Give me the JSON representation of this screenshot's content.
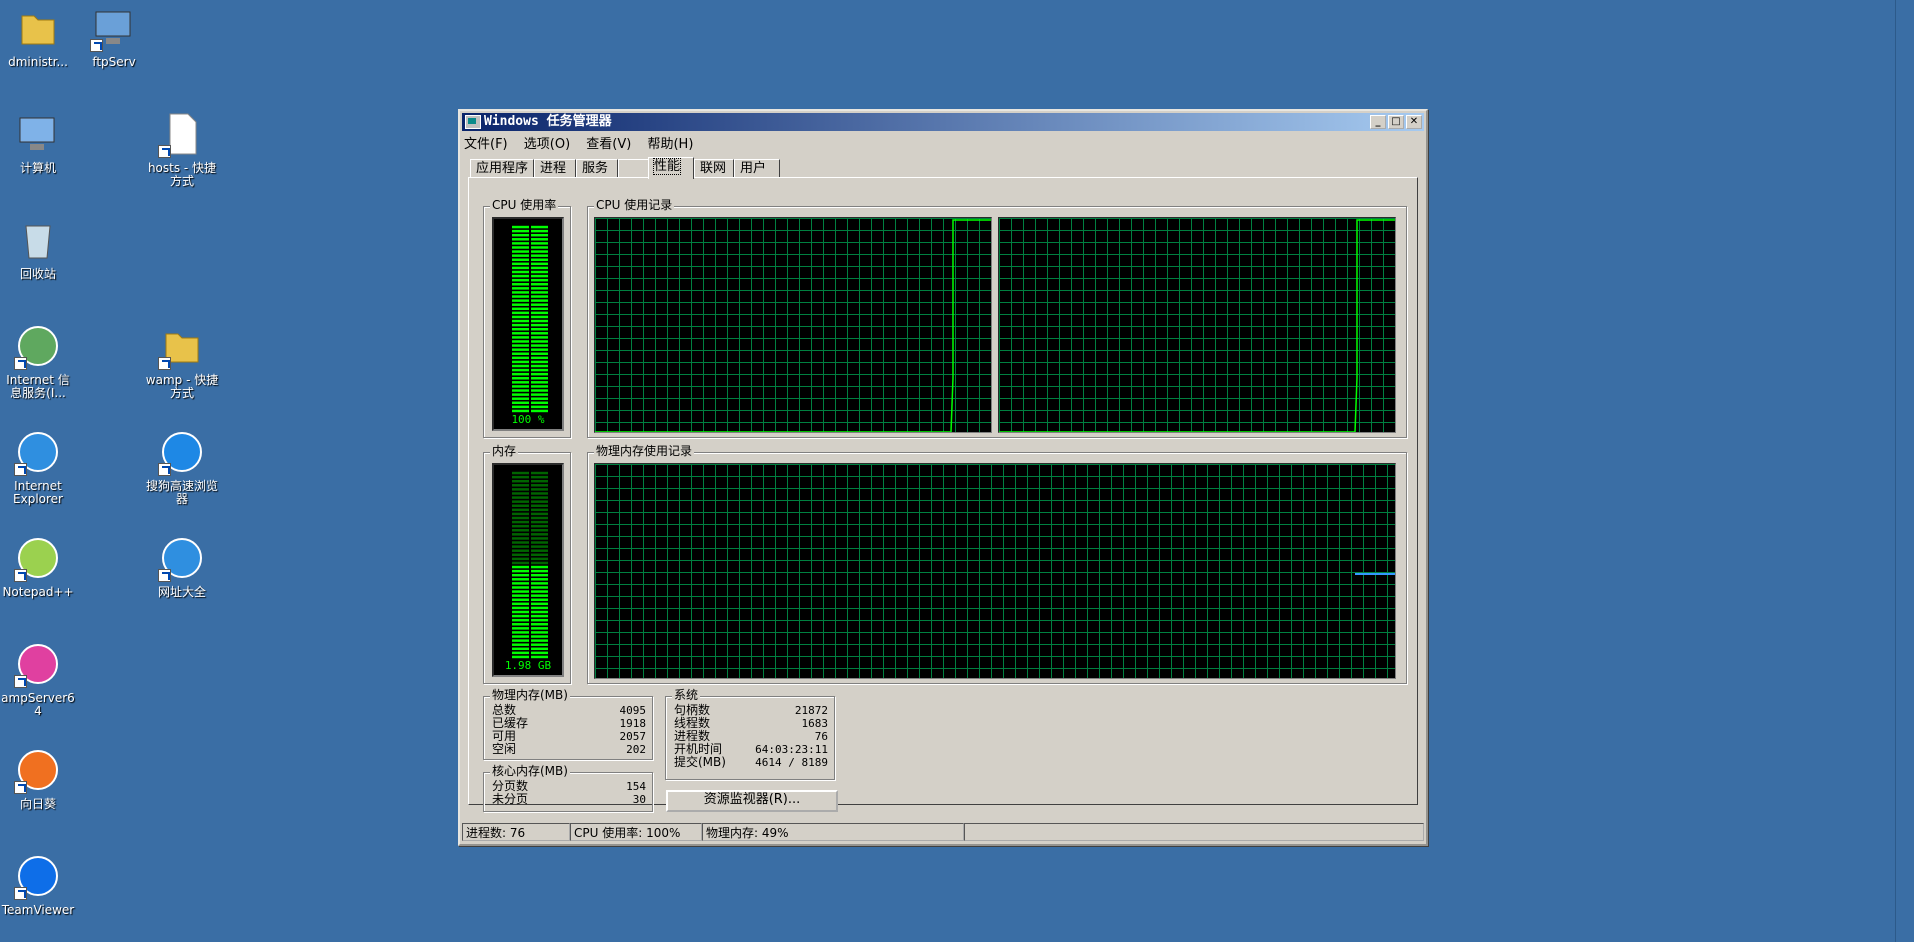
{
  "desktop": {
    "icons": [
      {
        "label": "dministr...",
        "icon": "folder-user-icon"
      },
      {
        "label": "ftpServ",
        "icon": "network-computers-icon"
      },
      {
        "label": "计算机",
        "icon": "computer-icon"
      },
      {
        "label": "hosts - 快捷\n方式",
        "icon": "file-shortcut-icon"
      },
      {
        "label": "回收站",
        "icon": "recycle-bin-icon"
      },
      {
        "label": "Internet 信\n息服务(I...",
        "icon": "iis-manager-icon"
      },
      {
        "label": "wamp - 快捷\n方式",
        "icon": "folder-shortcut-icon"
      },
      {
        "label": "Internet\nExplorer",
        "icon": "ie-icon"
      },
      {
        "label": "搜狗高速浏览\n器",
        "icon": "sogou-browser-icon"
      },
      {
        "label": "Notepad++",
        "icon": "notepadpp-icon"
      },
      {
        "label": "网址大全",
        "icon": "ie-icon"
      },
      {
        "label": "ampServer64",
        "icon": "wampserver-icon"
      },
      {
        "label": "向日葵",
        "icon": "sunflower-icon"
      },
      {
        "label": "TeamViewer",
        "icon": "teamviewer-icon"
      }
    ]
  },
  "window": {
    "title": "Windows 任务管理器",
    "menu": [
      "文件(F)",
      "选项(O)",
      "查看(V)",
      "帮助(H)"
    ],
    "tabs": [
      "应用程序",
      "进程",
      "服务",
      "性能",
      "联网",
      "用户"
    ],
    "active_tab": "性能",
    "cpu_usage": {
      "title": "CPU 使用率",
      "value_label": "100 %",
      "level": 1.0
    },
    "cpu_history": {
      "title": "CPU 使用记录"
    },
    "memory": {
      "title": "内存",
      "value_label": "1.98 GB",
      "level": 0.49
    },
    "memory_history": {
      "title": "物理内存使用记录"
    },
    "physical_memory": {
      "title": "物理内存(MB)",
      "rows": [
        {
          "k": "总数",
          "v": "4095"
        },
        {
          "k": "已缓存",
          "v": "1918"
        },
        {
          "k": "可用",
          "v": "2057"
        },
        {
          "k": "空闲",
          "v": "202"
        }
      ]
    },
    "kernel_memory": {
      "title": "核心内存(MB)",
      "rows": [
        {
          "k": "分页数",
          "v": "154"
        },
        {
          "k": "未分页",
          "v": "30"
        }
      ]
    },
    "system": {
      "title": "系统",
      "rows": [
        {
          "k": "句柄数",
          "v": "21872"
        },
        {
          "k": "线程数",
          "v": "1683"
        },
        {
          "k": "进程数",
          "v": "76"
        },
        {
          "k": "开机时间",
          "v": "64:03:23:11"
        },
        {
          "k": "提交(MB)",
          "v": "4614 / 8189"
        }
      ]
    },
    "resource_monitor_button": "资源监视器(R)...",
    "status": {
      "processes": "进程数: 76",
      "cpu": "CPU 使用率: 100%",
      "memory": "物理内存: 49%"
    }
  },
  "colors": {
    "desktop": "#3a6ea5",
    "graph_grid": "#008040",
    "graph_line": "#00ff00",
    "mem_line": "#3399ff"
  }
}
